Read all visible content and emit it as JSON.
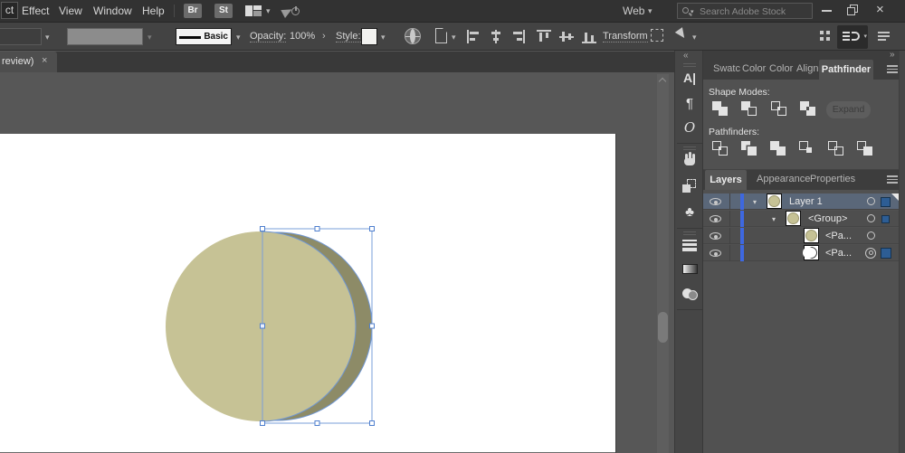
{
  "glyphs": {
    "chevron": "▾",
    "arrow_right": "›",
    "close": "×",
    "collapse_left": "«",
    "collapse_right": "»"
  },
  "colors": {
    "shape_light": "#c6c295",
    "shape_dark": "#8d8b67",
    "selection_blue": "#6f96d2",
    "handle_border": "#4f7fce",
    "layer_color_bar": "#3e68e0",
    "panel_bg": "#515151",
    "artboard": "#ffffff"
  },
  "menubar": {
    "items": [
      "ct",
      "Effect",
      "View",
      "Window",
      "Help"
    ],
    "bridge_button": "Br",
    "stock_button": "St",
    "icons": [
      "workspace-switcher-icon",
      "megaphone-icon"
    ],
    "mode_select": "Web",
    "search": {
      "placeholder": "Search Adobe Stock"
    },
    "window_controls": [
      "minimize",
      "restore",
      "close"
    ]
  },
  "controlbar": {
    "stroke_style_label": "Basic",
    "opacity_label": "Opacity:",
    "opacity_value": "100%",
    "style_label": "Style:",
    "transform_label": "Transform",
    "align_icons": [
      "align-left",
      "align-center-h",
      "align-right",
      "align-top",
      "align-middle-v",
      "align-bottom"
    ],
    "right_icons": [
      "dots-grid",
      "dock-arrange",
      "panel-menu"
    ]
  },
  "document_tab": {
    "title": "review)",
    "close": "×"
  },
  "dock_panels": [
    "character",
    "paragraph",
    "opentype",
    "hand",
    "transform",
    "symbols",
    "stroke",
    "gradient",
    "transparency"
  ],
  "dock_glyphs": {
    "character": "A|",
    "paragraph": "¶",
    "opentype": "O",
    "symbols": "♣"
  },
  "pathfinder": {
    "tabs": [
      "Swatc",
      "Color",
      "Color",
      "Align",
      "Pathfinder"
    ],
    "active_tab": "Pathfinder",
    "shape_modes_label": "Shape Modes:",
    "shape_mode_icons": [
      "unite",
      "minus-front",
      "intersect",
      "exclude"
    ],
    "expand_button": "Expand",
    "pathfinders_label": "Pathfinders:",
    "pathfinder_icons": [
      "divide",
      "trim",
      "merge",
      "crop",
      "outline",
      "minus-back"
    ]
  },
  "layers": {
    "tabs": [
      "Layers",
      "Appearance",
      "Properties"
    ],
    "active_tab": "Layers",
    "rows": [
      {
        "label": "Layer 1",
        "selected": true,
        "expanded": true,
        "thumb": "olive-circle"
      },
      {
        "label": "<Group>",
        "expanded": true,
        "thumb": "olive-circle"
      },
      {
        "label": "<Pa...",
        "thumb": "olive-circle"
      },
      {
        "label": "<Pa...",
        "thumb": "white-crescent"
      }
    ]
  }
}
